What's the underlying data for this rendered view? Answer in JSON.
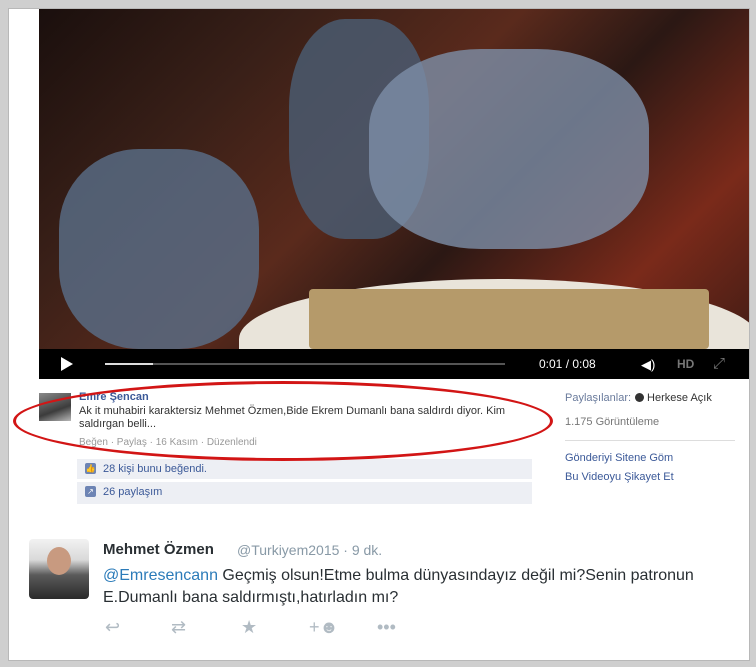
{
  "video": {
    "time": "0:01 / 0:08",
    "hd_label": "HD",
    "progress_fraction": 0.12
  },
  "comment": {
    "author": "Emre Şencan",
    "text": "Ak it muhabiri karaktersiz Mehmet Özmen,Bide Ekrem Dumanlı bana saldırdı diyor. Kim saldırgan belli...",
    "meta": "Beğen · Paylaş · 16 Kasım · Düzenlendi",
    "likes": "28 kişi bunu beğendi.",
    "shares": "26 paylaşım"
  },
  "sidebar": {
    "shared_with_label": "Paylaşılanlar:",
    "audience": "Herkese Açık",
    "views": "1.175 Görüntüleme",
    "embed": "Gönderiyi Sitene Göm",
    "report": "Bu Videoyu Şikayet Et"
  },
  "tweet": {
    "name": "Mehmet Özmen",
    "handle_time": "@Turkiyem2015 · 9 dk.",
    "mention": "@Emresencann",
    "text": " Geçmiş olsun!Etme bulma dünyasındayız değil mi?Senin patronun E.Dumanlı bana saldırmıştı,hatırladın mı?"
  },
  "colors": {
    "highlight_ellipse": "#d21515",
    "fb_link": "#3b5998",
    "twitter_mention": "#2b7bb9"
  },
  "icons": [
    "play-icon",
    "volume-icon",
    "fullscreen-icon",
    "globe-icon",
    "like-icon",
    "share-icon",
    "reply-icon",
    "retweet-icon",
    "favorite-icon",
    "follow-icon",
    "more-icon"
  ]
}
